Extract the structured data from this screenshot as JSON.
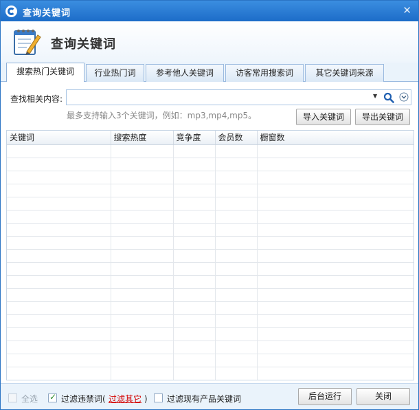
{
  "window": {
    "title": "查询关键词"
  },
  "header": {
    "title": "查询关键词"
  },
  "tabs": [
    {
      "label": "搜索热门关键词",
      "active": true
    },
    {
      "label": "行业热门词",
      "active": false
    },
    {
      "label": "参考他人关键词",
      "active": false
    },
    {
      "label": "访客常用搜索词",
      "active": false
    },
    {
      "label": "其它关键词来源",
      "active": false
    }
  ],
  "search": {
    "label": "查找相关内容:",
    "value": "",
    "placeholder": "",
    "hint": "最多支持输入3个关键词，例如：mp3,mp4,mp5。"
  },
  "buttons": {
    "import": "导入关键词",
    "export": "导出关键词",
    "background_run": "后台运行",
    "close": "关闭"
  },
  "table": {
    "columns": [
      "关键词",
      "搜索热度",
      "竞争度",
      "会员数",
      "橱窗数"
    ]
  },
  "footer": {
    "select_all": {
      "label": "全选",
      "checked": false,
      "disabled": true
    },
    "filter_banned": {
      "label": "过滤违禁词(",
      "checked": true
    },
    "filter_other_link": "过滤其它",
    "filter_banned_close": ")",
    "filter_existing": {
      "label": "过滤现有产品关键词",
      "checked": false
    }
  },
  "colors": {
    "titlebar": "#1c6cc8",
    "accent_link": "#d40000",
    "border": "#9cbbe0"
  }
}
